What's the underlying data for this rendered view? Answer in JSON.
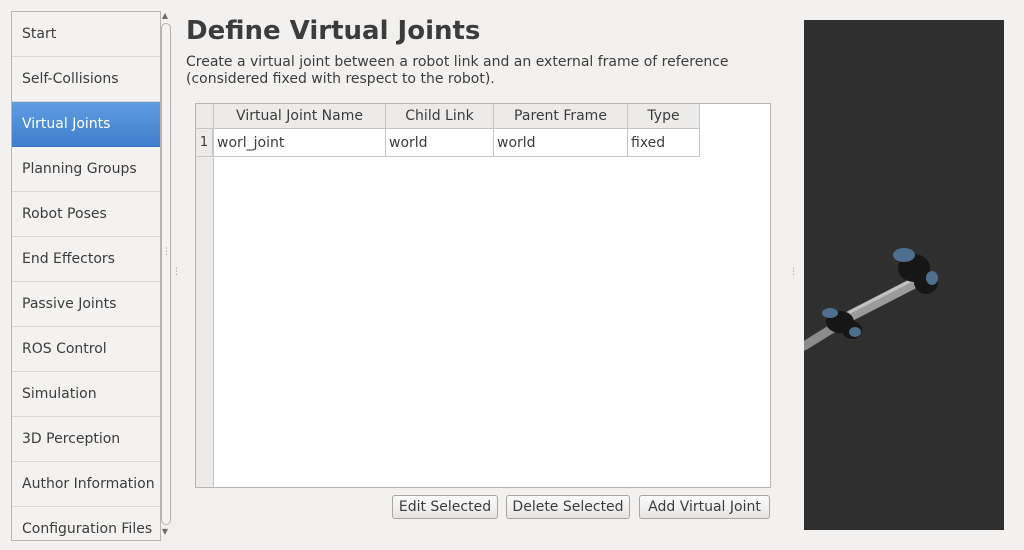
{
  "sidebar": {
    "items": [
      {
        "label": "Start",
        "active": false
      },
      {
        "label": "Self-Collisions",
        "active": false
      },
      {
        "label": "Virtual Joints",
        "active": true
      },
      {
        "label": "Planning Groups",
        "active": false
      },
      {
        "label": "Robot Poses",
        "active": false
      },
      {
        "label": "End Effectors",
        "active": false
      },
      {
        "label": "Passive Joints",
        "active": false
      },
      {
        "label": "ROS Control",
        "active": false
      },
      {
        "label": "Simulation",
        "active": false
      },
      {
        "label": "3D Perception",
        "active": false
      },
      {
        "label": "Author Information",
        "active": false
      },
      {
        "label": "Configuration Files",
        "active": false
      }
    ]
  },
  "main": {
    "title": "Define Virtual Joints",
    "description_line1": "Create a virtual joint between a robot link and an external frame of reference",
    "description_line2": "(considered fixed with respect to the robot).",
    "table": {
      "columns": [
        "Virtual Joint Name",
        "Child Link",
        "Parent Frame",
        "Type"
      ],
      "rows": [
        {
          "index": "1",
          "cells": [
            "worl_joint",
            "world",
            "world",
            "fixed"
          ]
        }
      ]
    },
    "buttons": {
      "edit_selected": "Edit Selected",
      "delete_selected": "Delete Selected",
      "add_virtual_joint": "Add Virtual Joint"
    }
  },
  "colors": {
    "selection": "#4a8bd6",
    "window_bg": "#f2f1f0",
    "viewport_bg": "#2f2f2f"
  }
}
